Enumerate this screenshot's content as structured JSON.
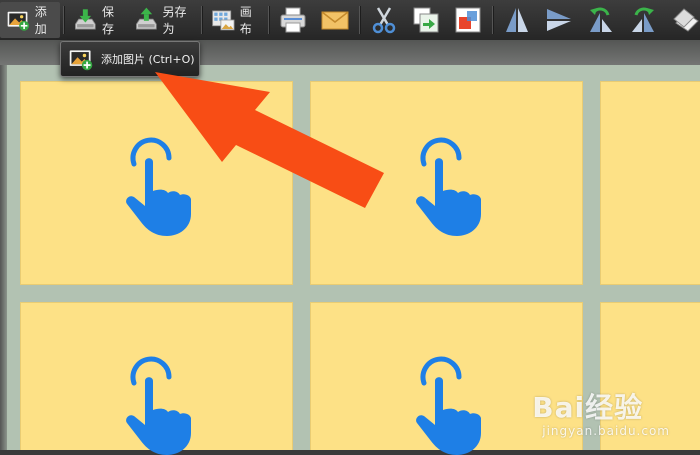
{
  "toolbar": {
    "add_label": "添加",
    "save_label": "保存",
    "save_as_label": "另存为",
    "canvas_label": "画布"
  },
  "tooltip": {
    "text": "添加图片 (Ctrl+O)"
  },
  "watermark": {
    "main": "Bai经验",
    "sub": "jingyan.baidu.com"
  },
  "colors": {
    "cell_fill": "#fde186",
    "canvas_bg": "#b2c2b2",
    "hand_blue": "#1e7fe6",
    "arrow_orange": "#f84d15"
  }
}
